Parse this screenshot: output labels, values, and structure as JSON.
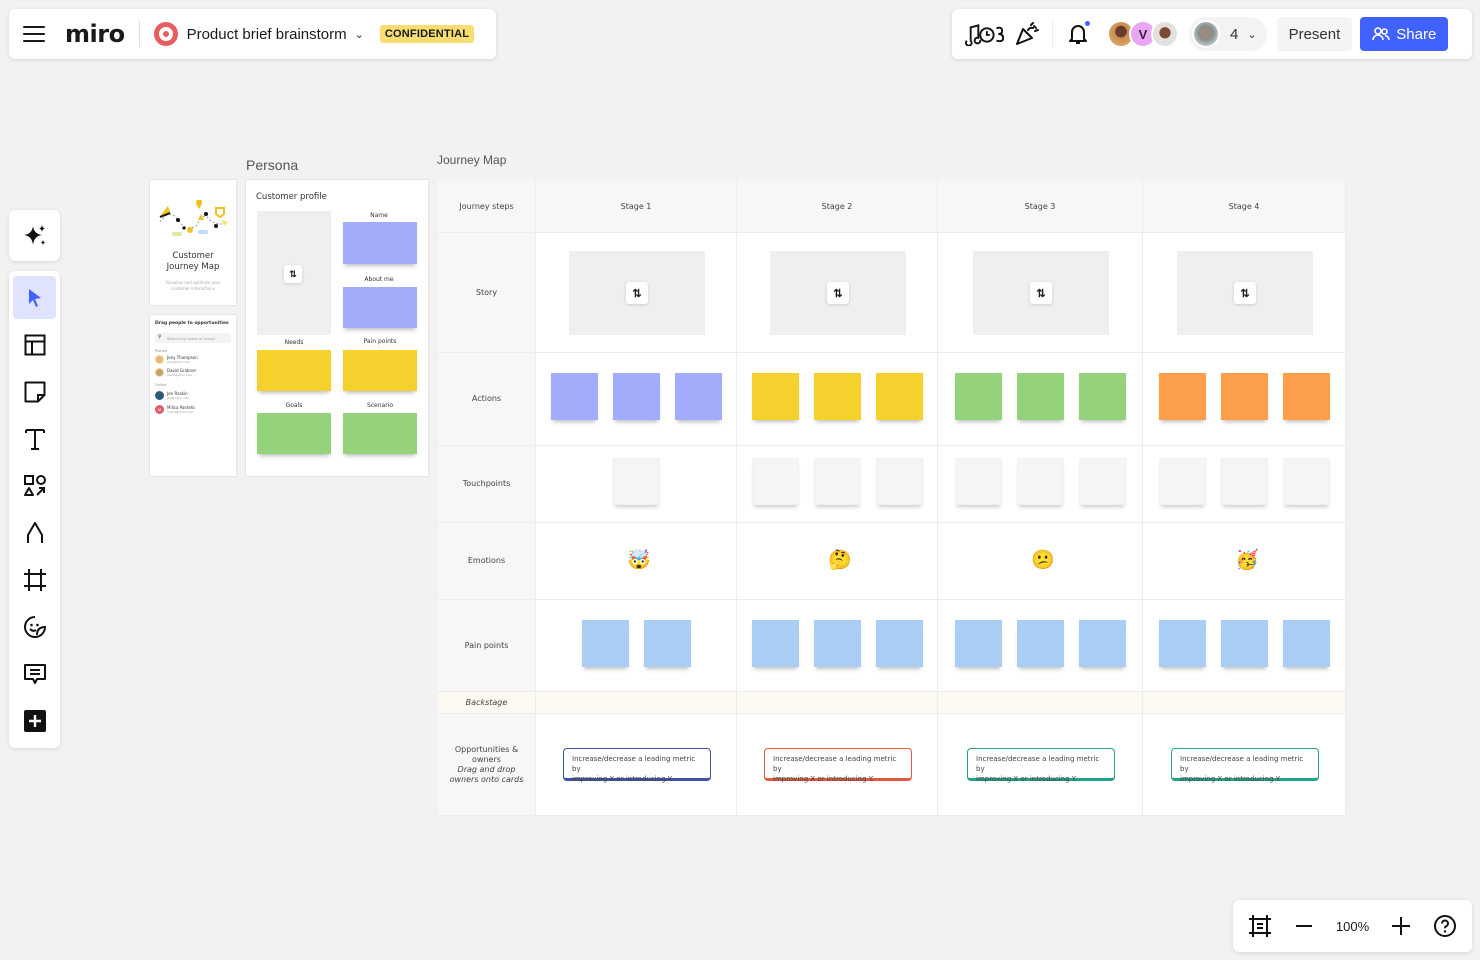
{
  "topbar": {
    "logo": "miro",
    "board_title": "Product brief brainstorm",
    "badge": "CONFIDENTIAL",
    "collaborator_count": "4",
    "avatar_initial": "V",
    "present_label": "Present",
    "share_label": "Share"
  },
  "toolbar": {
    "items": [
      "ai-assist",
      "select",
      "templates",
      "sticky-note",
      "text",
      "shapes",
      "pen",
      "frame",
      "stickers",
      "comment",
      "more"
    ]
  },
  "zoom": {
    "value": "100%"
  },
  "persona": {
    "title": "Persona",
    "cover": {
      "title_line1": "Customer",
      "title_line2": "Journey Map",
      "subtitle_line1": "Visualize and optimize your",
      "subtitle_line2": "customer interactions"
    },
    "people_panel": {
      "title": "Drag people to opportunities",
      "search_placeholder": "Search by name or email",
      "group1": "Pinned",
      "group2": "Online",
      "people": [
        {
          "name": "Joey Thompson",
          "email": "joey@miro.com",
          "color": "#e8b87a"
        },
        {
          "name": "David Grabner",
          "email": "david@miro.com",
          "color": "#c9a06a"
        },
        {
          "name": "Jen Raskin",
          "email": "jen@miro.com",
          "color": "#2b5a7a"
        },
        {
          "name": "Milica Pantelic",
          "email": "milica@miro.com",
          "color": "#e05a6a",
          "initial": "M"
        }
      ]
    },
    "profile": {
      "title": "Customer profile",
      "name_label": "Name",
      "about_label": "About me",
      "needs_label": "Needs",
      "pain_label": "Pain points",
      "goals_label": "Goals",
      "scenario_label": "Scenario"
    }
  },
  "journey": {
    "title": "Journey Map",
    "header_label": "Journey steps",
    "stages": [
      "Stage 1",
      "Stage 2",
      "Stage 3",
      "Stage 4"
    ],
    "rows": {
      "story": "Story",
      "actions": "Actions",
      "touchpoints": "Touchpoints",
      "emotions": "Emotions",
      "pain": "Pain points",
      "backstage": "Backstage",
      "opp_line1": "Opportunities &",
      "opp_line2": "owners",
      "opp_hint1": "Drag and drop",
      "opp_hint2": "owners onto cards"
    },
    "action_colors": [
      "#a3acfb",
      "#f5d12e",
      "#94d37c",
      "#fd9f4a"
    ],
    "touchpoint_counts": [
      1,
      3,
      3,
      3
    ],
    "pain_counts": [
      2,
      3,
      3,
      3
    ],
    "pain_color": "#a9cdf3",
    "touchpoint_color": "#f4f5f6",
    "emotions": [
      "🤯",
      "🤔",
      "😕",
      "🥳"
    ],
    "opportunities": [
      {
        "text_line1": "Increase/decrease a leading metric by",
        "text_line2": "improving X or introducing Y.",
        "color": "#4052a8"
      },
      {
        "text_line1": "Increase/decrease a leading metric by",
        "text_line2": "improving X or introducing Y.",
        "color": "#e05a3e"
      },
      {
        "text_line1": "Increase/decrease a leading metric by",
        "text_line2": "improving X or introducing Y.",
        "color": "#22a38a"
      },
      {
        "text_line1": "Increase/decrease a leading metric by",
        "text_line2": "improving X or introducing Y.",
        "color": "#22a38a"
      }
    ]
  }
}
